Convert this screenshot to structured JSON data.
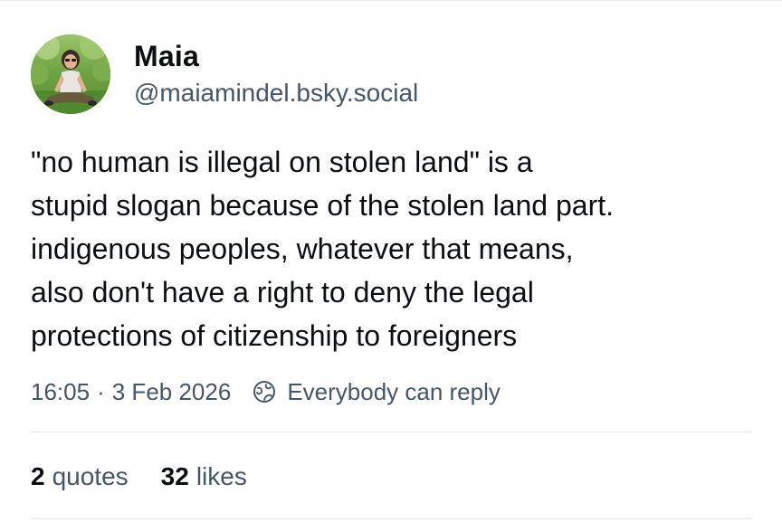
{
  "author": {
    "display_name": "Maia",
    "handle": "@maiamindel.bsky.social"
  },
  "post": {
    "text_lines": [
      "\"no human is illegal on stolen land\" is a",
      "stupid slogan because of the stolen land part.",
      "indigenous peoples, whatever that means,",
      "also don't have a right to deny the legal",
      "protections of citizenship to foreigners"
    ],
    "time": "16:05",
    "separator": "·",
    "date": "3 Feb 2026",
    "reply_setting": "Everybody can reply",
    "reply_icon": "globe-icon"
  },
  "stats": {
    "quotes": {
      "count": "2",
      "label": "quotes"
    },
    "likes": {
      "count": "32",
      "label": "likes"
    }
  },
  "colors": {
    "text": "#0b0f14",
    "secondary": "#42576c",
    "divider": "#e3e7ec"
  }
}
